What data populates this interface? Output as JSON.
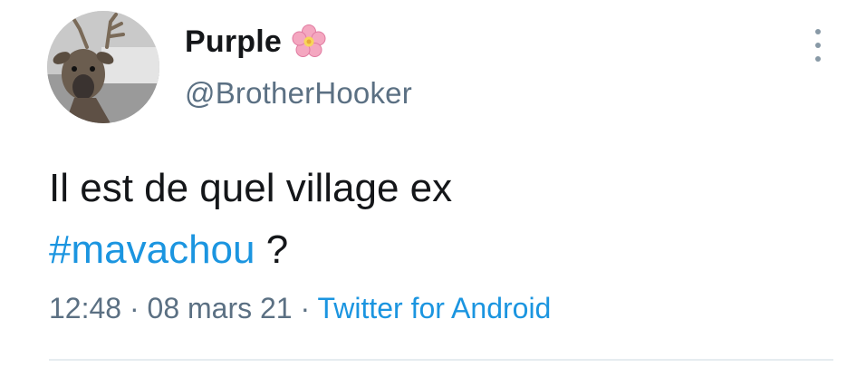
{
  "tweet": {
    "display_name": "Purple",
    "name_emoji": "cherry-blossom-icon",
    "handle": "@BrotherHooker",
    "text_line1": "Il est de quel village ex",
    "hashtag": "#mavachou",
    "text_after_hashtag": " ?",
    "time": "12:48",
    "separator": " · ",
    "date": "08 mars 21",
    "source": "Twitter for Android"
  },
  "colors": {
    "link": "#1b95e0",
    "secondary_text": "#5b7083",
    "primary_text": "#141619",
    "divider": "#e6ecf0"
  },
  "icons": {
    "more": "more-vertical-icon",
    "avatar": "deer-avatar"
  }
}
